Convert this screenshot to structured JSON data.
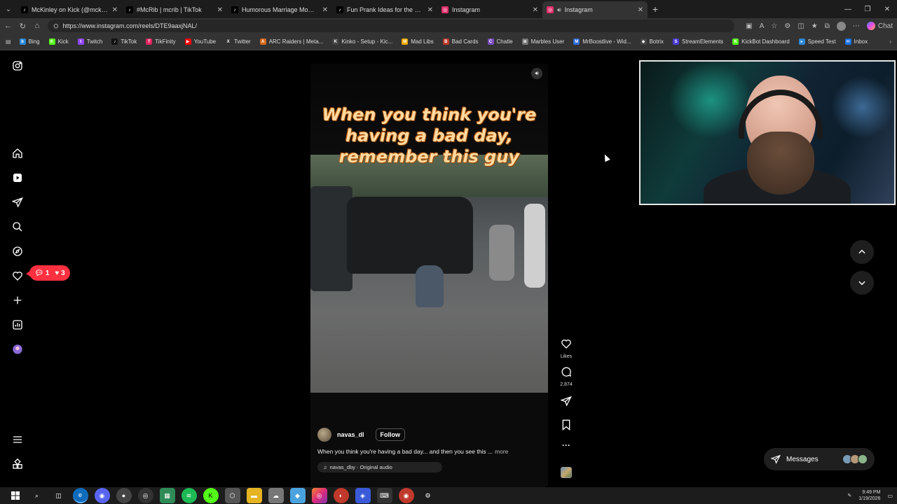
{
  "browser": {
    "tabs": [
      {
        "title": "McKinley on Kick (@mckinley.tv) |",
        "icon": "tiktok-icon",
        "color": "#000000",
        "active": false
      },
      {
        "title": "#McRib | mcrib | TikTok",
        "icon": "tiktok-icon",
        "color": "#000000",
        "active": false
      },
      {
        "title": "Humorous Marriage Moments: Th",
        "icon": "tiktok-icon",
        "color": "#000000",
        "active": false
      },
      {
        "title": "Fun Prank Ideas for the New Guy",
        "icon": "tiktok-icon",
        "color": "#000000",
        "active": false
      },
      {
        "title": "Instagram",
        "icon": "instagram-icon",
        "color": "#e1306c",
        "active": false
      },
      {
        "title": "Instagram",
        "icon": "instagram-icon",
        "color": "#e1306c",
        "active": true
      }
    ],
    "url": "https://www.instagram.com/reels/DTE9aaxjNAL/",
    "chat_label": "Chat",
    "bookmarks": [
      {
        "label": "Bing",
        "color": "#2b88d8",
        "glyph": "b"
      },
      {
        "label": "Kick",
        "color": "#53fc18",
        "glyph": "K"
      },
      {
        "label": "Twitch",
        "color": "#9146ff",
        "glyph": "t"
      },
      {
        "label": "TikTok",
        "color": "#111111",
        "glyph": "♪"
      },
      {
        "label": "TikFinity",
        "color": "#e0245e",
        "glyph": "T"
      },
      {
        "label": "YouTube",
        "color": "#ff0000",
        "glyph": "▶"
      },
      {
        "label": "Twitter",
        "color": "#333333",
        "glyph": "X"
      },
      {
        "label": "ARC Raiders | Meta...",
        "color": "#d4691b",
        "glyph": "A"
      },
      {
        "label": "Kinko - Setup - Kic...",
        "color": "#444444",
        "glyph": "K"
      },
      {
        "label": "Mad Libs",
        "color": "#f2a900",
        "glyph": "M"
      },
      {
        "label": "Bad Cards",
        "color": "#c0392b",
        "glyph": "B"
      },
      {
        "label": "Chatle",
        "color": "#7a4cc2",
        "glyph": "C"
      },
      {
        "label": "Marbles User",
        "color": "#777777",
        "glyph": "⊕"
      },
      {
        "label": "MrBoostlive - Wid...",
        "color": "#2f6bd8",
        "glyph": "M"
      },
      {
        "label": "Botrix",
        "color": "#444444",
        "glyph": "◆"
      },
      {
        "label": "StreamElements",
        "color": "#4b3bd6",
        "glyph": "S"
      },
      {
        "label": "KickBot Dashboard",
        "color": "#53fc18",
        "glyph": "K"
      },
      {
        "label": "Speed Test",
        "color": "#2b88d8",
        "glyph": "▸"
      },
      {
        "label": "Inbox",
        "color": "#1a73e8",
        "glyph": "✉"
      }
    ]
  },
  "reel": {
    "caption_overlay": "When you think you're having a bad day, remember this guy",
    "username": "navas_dl",
    "follow_label": "Follow",
    "description": "When you think you're having a bad day... and then you see this ...",
    "more_label": "more",
    "audio": "navas_dby · Original audio",
    "likes_label": "Likes",
    "comments_count": "2,874"
  },
  "notifications": {
    "comments": "1",
    "likes": "3"
  },
  "messages_label": "Messages",
  "taskbar": {
    "time": "9:49 PM",
    "date": "1/19/2026"
  },
  "colors": {
    "notif_red": "#ff3040",
    "accent_blue": "#6ab4ff"
  }
}
